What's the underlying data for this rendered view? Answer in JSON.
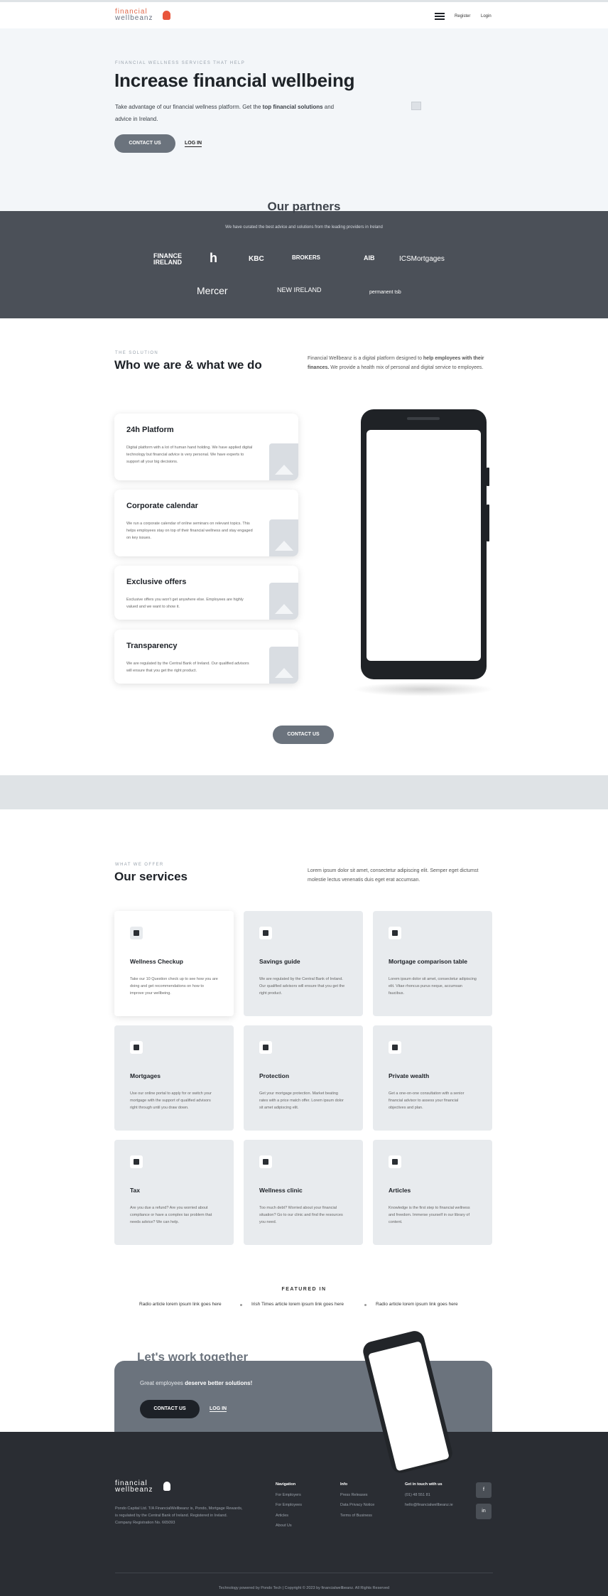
{
  "header": {
    "logo_line1": "financial",
    "logo_line2": "wellbeanz",
    "register": "Register",
    "login": "Login"
  },
  "hero": {
    "eyebrow": "FINANCIAL WELLNESS SERVICES THAT HELP",
    "title": "Increase financial wellbeing",
    "desc_start": "Take advantage of our financial wellness platform. Get the ",
    "desc_bold": "top financial solutions",
    "desc_end": " and advice in Ireland.",
    "contact": "CONTACT US",
    "login": "LOG IN"
  },
  "partners": {
    "title": "Our partners",
    "subtitle": "We have curated the best advice and solutions from the leading providers in Ireland",
    "logos": [
      "FINANCE IRELAND",
      "h",
      "KBC",
      "BROKERS",
      "AIB",
      "ICSMortgages",
      "Mercer",
      "NEW IRELAND",
      "permanent tsb"
    ]
  },
  "who": {
    "eyebrow": "THE SOLUTION",
    "title": "Who we are & what we do",
    "intro_start": "Financial Wellbeanz is a digital platform designed to ",
    "intro_bold": "help employees with their finances.",
    "intro_end": " We provide a health mix of personal and digital service to employees.",
    "features": [
      {
        "title": "24h Platform",
        "text": "Digital platform with a lot of human hand holding. We have applied digital technology but financial advice is very personal. We have experts to support all your big decisions."
      },
      {
        "title": "Corporate calendar",
        "text": "We run a corporate calendar of online seminars on relevant topics. This helps employees stay on top of their financial wellness and stay engaged on key issues."
      },
      {
        "title": "Exclusive offers",
        "text": "Exclusive offers you won't get anywhere else. Employees are highly valued and we want to show it."
      },
      {
        "title": "Transparency",
        "text": "We are regulated by the Central Bank of Ireland. Our qualified advisors will ensure that you get the right product."
      }
    ],
    "contact": "CONTACT US"
  },
  "services": {
    "eyebrow": "WHAT WE OFFER",
    "title": "Our services",
    "intro": "Lorem ipsum dolor sit amet, consectetur adipiscing elit. Semper eget dictumst molestie lectus venenatis duis eget erat accumsan.",
    "cards": [
      {
        "title": "Wellness Checkup",
        "text": "Take our 10 Question check up to see how you are doing and get recommendations on how to improve your wellbeing."
      },
      {
        "title": "Savings guide",
        "text": "We are regulated by the Central Bank of Ireland. Our qualified advisors will ensure that you get the right product."
      },
      {
        "title": "Mortgage comparison table",
        "text": "Lorem ipsum dolor sit amet, consectetur adipiscing elit. Vitae rhoncus purus neque, accumsan faucibus."
      },
      {
        "title": "Mortgages",
        "text": "Use our online portal to apply for or switch your mortgage with the support of qualified advisors right through until you draw down."
      },
      {
        "title": "Protection",
        "text": "Get your mortgage protection. Market beating rates with a price match offer. Lorem ipsum dolor sit amet adipiscing elit."
      },
      {
        "title": "Private wealth",
        "text": "Get a one-on-one consultation with a senior financial advisor to assess your financial objectives and plan."
      },
      {
        "title": "Tax",
        "text": "Are you due a refund? Are you worried about compliance or have a complex tax problem that needs advice? We can help."
      },
      {
        "title": "Wellness clinic",
        "text": "Too much debt? Worried about your financial situation? Go to our clinic and find the resources you need."
      },
      {
        "title": "Articles",
        "text": "Knowledge is the first step to financial wellness and freedom. Immerse yourself in our library of content."
      }
    ]
  },
  "featured": {
    "label": "FEATURED IN",
    "links": [
      "Radio article lorem ipsum link goes here",
      "Irish Times article lorem ipsum link goes here",
      "Radio article lorem ipsum link goes here"
    ]
  },
  "cta": {
    "title": "Let's work together",
    "text_start": "Great employees ",
    "text_bold": "deserve better solutions!",
    "contact": "CONTACT US",
    "login": "LOG IN"
  },
  "footer": {
    "logo_line1": "financial",
    "logo_line2": "wellbeanz",
    "desc": "Pondo Capital Ltd. T/A FinancialWellbeanz is, Pondo, Mortgage Rewards, is regulated by the Central Bank of Ireland. Registered in Ireland. Company Registration No. 665093",
    "col1_title": "Navigation",
    "col1_items": [
      "For Employers",
      "For Employees",
      "Articles",
      "About Us"
    ],
    "col2_title": "Info",
    "col2_items": [
      "Press Releases",
      "Data Privacy Notice",
      "Terms of Business"
    ],
    "col3_title": "Get in touch with us",
    "col3_items": [
      "(01) 48 551 81",
      "hello@financialwellbeanz.ie"
    ],
    "social1": "f",
    "social2": "in",
    "copyright": "Technology powered by Pondo Tech | Copyright © 2023 by financialwellbeanz. All Rights Reserved"
  },
  "colors": {
    "accent_orange": "#e06b4f",
    "dark_button": "#6b737d",
    "partners_bg": "#4b5058",
    "footer_bg": "#2a2d33"
  }
}
